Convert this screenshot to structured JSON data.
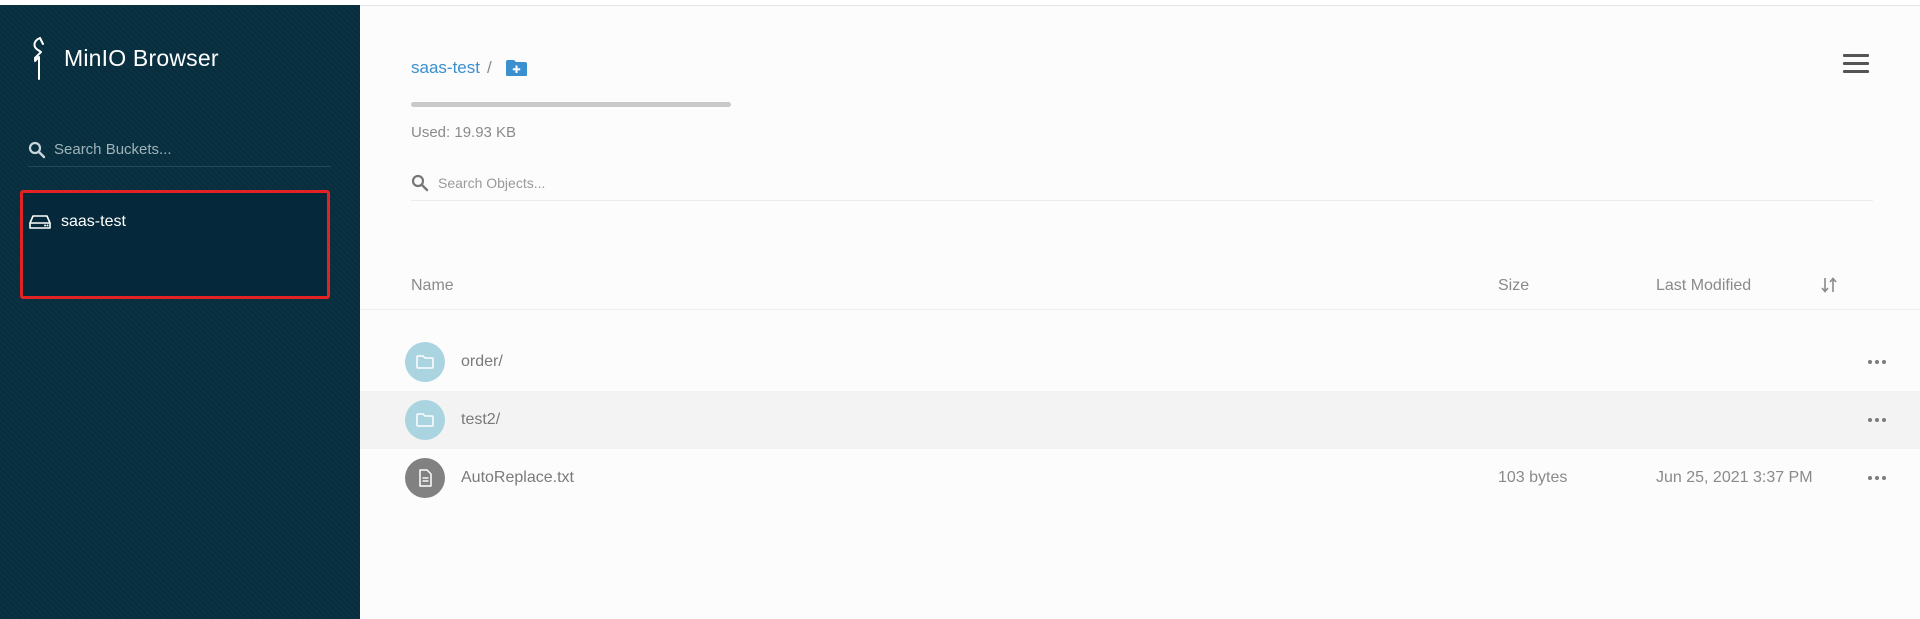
{
  "sidebar": {
    "brand_title": "MinIO Browser",
    "search_placeholder": "Search Buckets...",
    "buckets": [
      {
        "name": "saas-test",
        "icon": "hard-drive-icon"
      }
    ],
    "colors": {
      "background": "#072e3e",
      "highlight_border": "#e32323"
    }
  },
  "main": {
    "breadcrumb": {
      "bucket": "saas-test",
      "separator": "/"
    },
    "usage": {
      "text": "Used: 19.93 KB"
    },
    "search_placeholder": "Search Objects...",
    "table": {
      "columns": {
        "name": "Name",
        "size": "Size",
        "last_modified": "Last Modified"
      },
      "rows": [
        {
          "type": "folder",
          "name": "order/",
          "size": "",
          "last_modified": ""
        },
        {
          "type": "folder",
          "name": "test2/",
          "size": "",
          "last_modified": ""
        },
        {
          "type": "file",
          "name": "AutoReplace.txt",
          "size": "103 bytes",
          "last_modified": "Jun 25, 2021 3:37 PM"
        }
      ]
    },
    "colors": {
      "link": "#3a8fcf",
      "folder_icon_bg": "#a9d4e0",
      "file_icon_bg": "#818181"
    }
  }
}
